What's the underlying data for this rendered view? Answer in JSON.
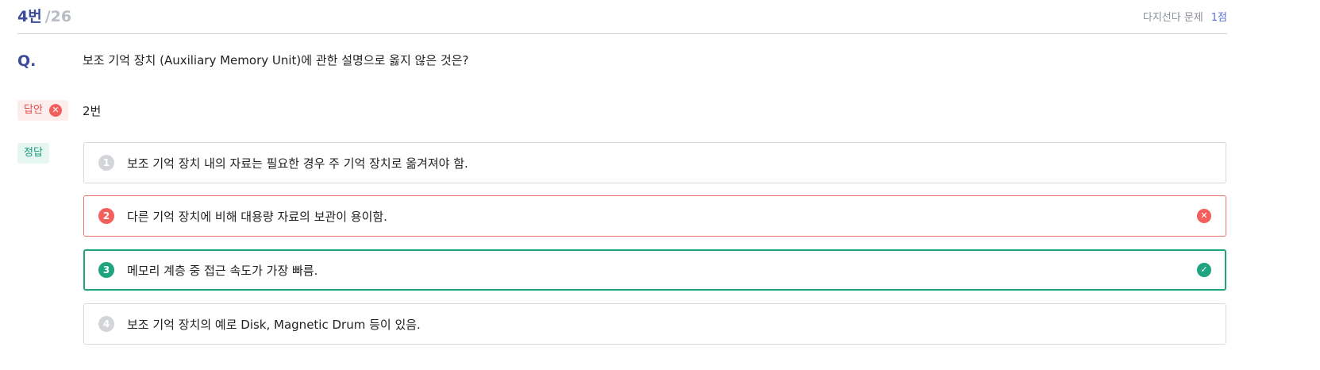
{
  "header": {
    "number": "4번",
    "total": "/26",
    "type": "다지선다 문제",
    "score": "1점"
  },
  "question": {
    "label": "Q.",
    "text": "보조 기억 장치 (Auxiliary Memory Unit)에 관한 설명으로 옳지 않은 것은?"
  },
  "answer": {
    "tag": "답안",
    "value": "2번"
  },
  "correct": {
    "tag": "정답"
  },
  "options": [
    {
      "num": "1",
      "text": "보조 기억 장치 내의 자료는 필요한 경우 주 기억 장치로 옮겨져야 함."
    },
    {
      "num": "2",
      "text": "다른 기억 장치에 비해 대용량 자료의 보관이 용이함."
    },
    {
      "num": "3",
      "text": "메모리 계층 중 접근 속도가 가장 빠름."
    },
    {
      "num": "4",
      "text": "보조 기억 장치의 예로 Disk, Magnetic Drum 등이 있음."
    }
  ],
  "icons": {
    "wrong": "x-circle-icon",
    "right": "check-circle-icon"
  },
  "colors": {
    "accent": "#3b4a9a",
    "wrong": "#f25f5c",
    "right": "#1fa47f"
  }
}
